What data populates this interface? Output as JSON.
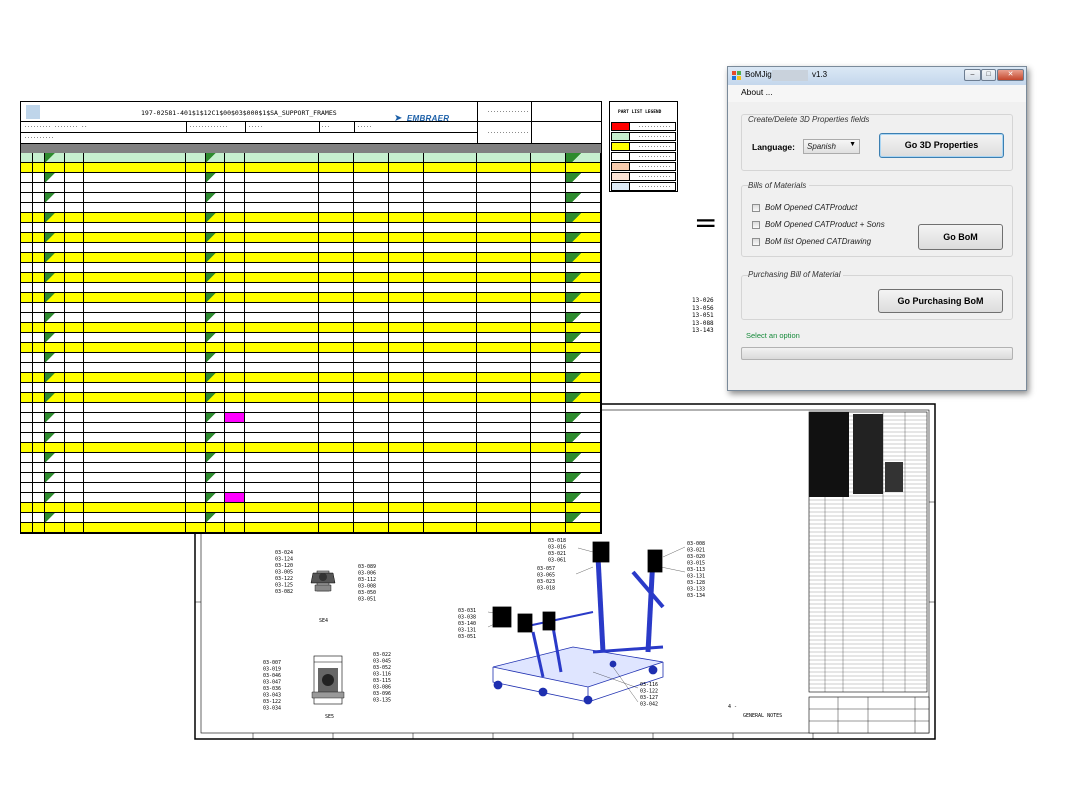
{
  "app": {
    "title": "BoMJig",
    "version": "v1.3",
    "menu_about": "About ...",
    "groups": {
      "properties_title": "Create/Delete 3D Properties fields",
      "language_label": "Language:",
      "language_value": "Spanish",
      "go_3d_label": "Go 3D Properties",
      "bom_title": "Bills of Materials",
      "checkboxes": [
        {
          "label": "BoM Opened CATProduct",
          "checked": false
        },
        {
          "label": "BoM Opened CATProduct + Sons",
          "checked": false
        },
        {
          "label": "BoM list Opened CATDrawing",
          "checked": false
        }
      ],
      "go_bom_label": "Go BoM",
      "purchasing_title": "Purchasing Bill of Material",
      "go_purchasing_label": "Go Purchasing BoM"
    },
    "status_text": "Select an option",
    "progress": 0
  },
  "sheet": {
    "title": "197-02581-401$1$12C1$00$03$000$1$SA_SUPPORT_FRAMES",
    "logo": "EMBRAER",
    "colors": {
      "green": "#c6efce",
      "yellow": "#ffff00",
      "magenta": "#ff00ff",
      "white": "#ffffff"
    }
  },
  "legend": {
    "title": "PART LIST LEGEND",
    "swatches": [
      "#ff0000",
      "#c6efce",
      "#ffff00",
      "#ffffff",
      "#f8cbad",
      "#fce4d6",
      "#ddebf7"
    ]
  },
  "equals": "=",
  "side_labels": [
    "13-026",
    "13-056",
    "13-051",
    "13-088",
    "13-143"
  ],
  "drawing": {
    "detail_a_labels": [
      "03-024",
      "03-124",
      "03-120",
      "03-005",
      "03-122",
      "03-125",
      "03-082"
    ],
    "detail_a_right": [
      "03-089",
      "03-006",
      "03-112",
      "03-008",
      "03-050",
      "03-051"
    ],
    "detail_a_caption": "SE4",
    "detail_b_labels": [
      "03-007",
      "03-019",
      "03-046",
      "03-047",
      "03-036",
      "03-043",
      "03-122",
      "03-034"
    ],
    "detail_b_right": [
      "03-022",
      "03-045",
      "03-052",
      "03-116",
      "03-115",
      "03-086",
      "03-096",
      "03-135"
    ],
    "detail_b_caption": "SE5",
    "main_left": [
      "03-031",
      "03-038",
      "03-140",
      "03-131",
      "03-051"
    ],
    "main_top": [
      "03-018",
      "03-016",
      "03-021",
      "03-061"
    ],
    "main_mid": [
      "03-057",
      "03-065",
      "03-023",
      "03-018"
    ],
    "main_right": [
      "03-008",
      "03-021",
      "03-020",
      "03-015",
      "03-113",
      "03-131",
      "03-128",
      "03-133",
      "03-134"
    ],
    "main_bottom": [
      "03-116",
      "03-122",
      "03-127",
      "03-042"
    ],
    "general_notes": "GENERAL NOTES"
  }
}
